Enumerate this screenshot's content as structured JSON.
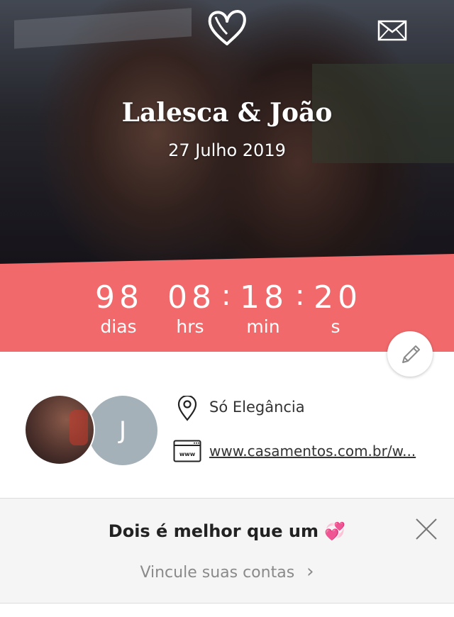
{
  "hero": {
    "names": "Lalesca & João",
    "date": "27 Julho 2019",
    "icons": {
      "logo": "heart-icon",
      "message": "mail-icon"
    }
  },
  "countdown": {
    "days": "98",
    "hours": "08",
    "minutes": "18",
    "seconds": "20",
    "days_label": "dias",
    "hours_label": "hrs",
    "minutes_label": "min",
    "seconds_label": "s",
    "separator": ":",
    "color": "#f2696b"
  },
  "profile": {
    "initial": "J",
    "venue": "Só Elegância",
    "website": "www.casamentos.com.br/w..."
  },
  "promo": {
    "title": "Dois é melhor que um",
    "title_emoji": "💞",
    "link": "Vincule suas contas",
    "link_arrow": "›"
  }
}
